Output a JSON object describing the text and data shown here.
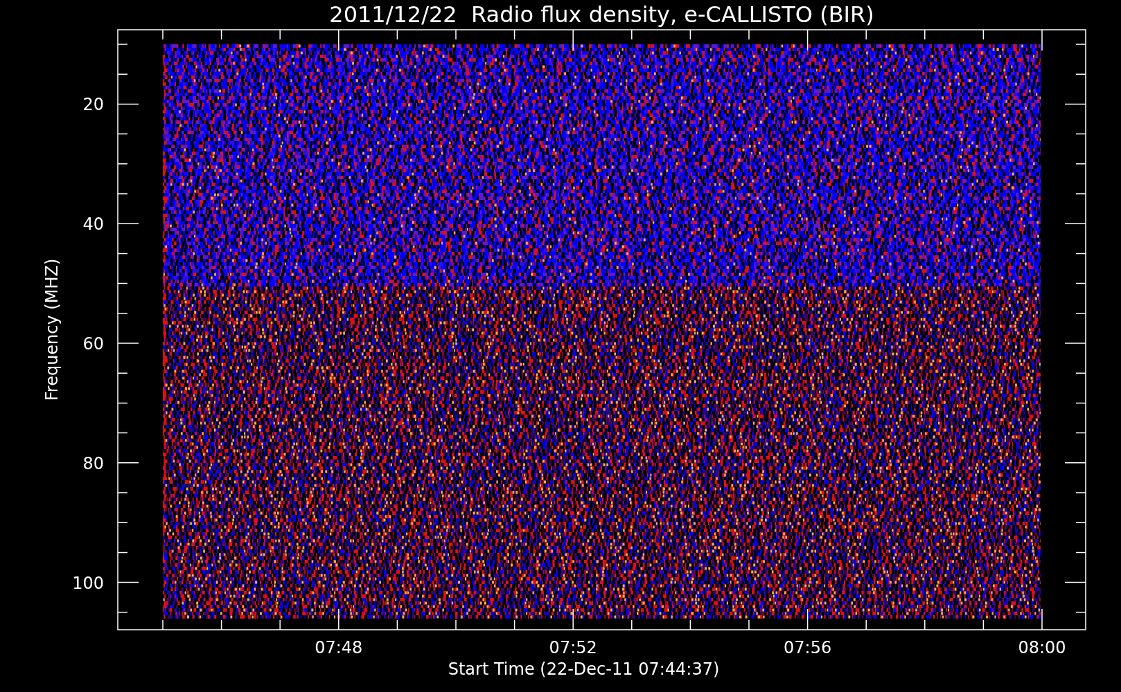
{
  "title": "2011/12/22  Radio flux density, e-CALLISTO (BIR)",
  "y_axis": {
    "label": "Frequency (MHZ)",
    "ticks": [
      "20",
      "40",
      "60",
      "80",
      "100"
    ]
  },
  "x_axis": {
    "label": "Start Time (22-Dec-11 07:44:37)",
    "ticks": [
      "07:48",
      "07:52",
      "07:56",
      "08:00"
    ]
  }
}
